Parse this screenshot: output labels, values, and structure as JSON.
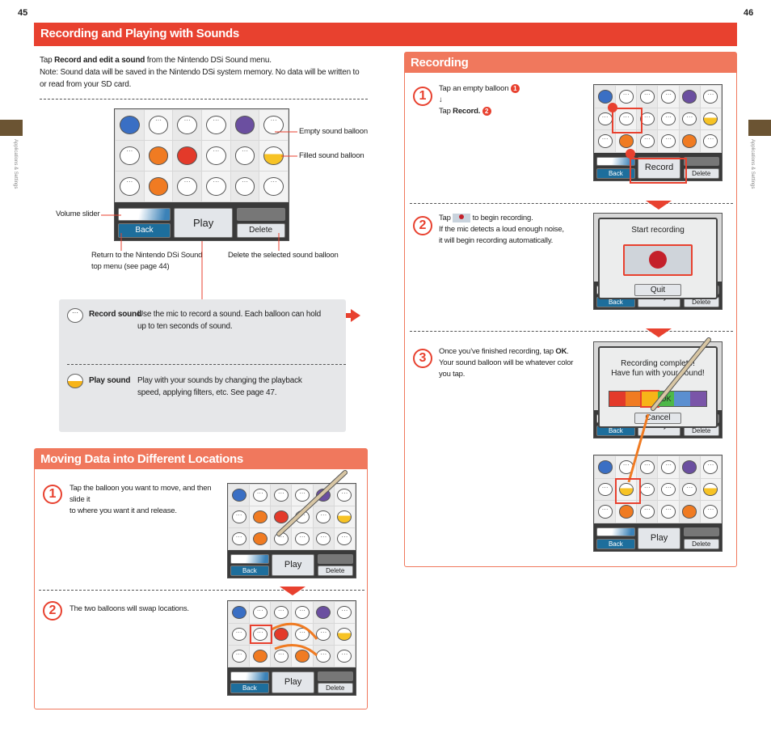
{
  "page_numbers": {
    "left": "45",
    "right": "46"
  },
  "side_tab": "Applications & Settings",
  "main_header": "Recording and Playing with Sounds",
  "intro": {
    "l1_pre": "Tap ",
    "l1_bold": "Record and edit a sound",
    "l1_post": " from the Nintendo DSi Sound menu.",
    "l2": "Note: Sound data will be saved in the Nintendo DSi system memory. No data will be written to",
    "l3": "or read from your SD card."
  },
  "callouts": {
    "empty": "Empty sound balloon",
    "filled": "Filled sound balloon",
    "volume": "Volume slider",
    "return1": "Return to the Nintendo DSi Sound",
    "return2": "top menu (see page 44)",
    "delete": "Delete the selected sound balloon"
  },
  "screen_ui": {
    "back": "Back",
    "play": "Play",
    "delete": "Delete",
    "record": "Record",
    "start_recording": "Start recording",
    "quit": "Quit",
    "complete1": "Recording complete!",
    "complete2": "Have fun with your sound!",
    "ok": "OK",
    "cancel": "Cancel"
  },
  "colors": {
    "accent": "#e8412f",
    "panel": "#f0785d",
    "blue": "#3a6fc4",
    "orange": "#f07b22",
    "red": "#e33a2a",
    "yellow": "#f7c325",
    "purple": "#6b4fa0"
  },
  "balloon_grids": {
    "main": [
      [
        "blue",
        "empty",
        "empty",
        "empty",
        "purple",
        "empty"
      ],
      [
        "empty",
        "orange",
        "red",
        "empty",
        "empty",
        "yellow"
      ],
      [
        "empty",
        "orange",
        "empty",
        "empty",
        "empty",
        "empty"
      ]
    ],
    "move1": [
      [
        "blue",
        "empty",
        "empty",
        "empty",
        "purple",
        "empty"
      ],
      [
        "empty",
        "orange",
        "red",
        "empty",
        "empty",
        "yellow"
      ],
      [
        "empty",
        "orange",
        "empty",
        "empty",
        "empty",
        "empty"
      ]
    ],
    "move2": [
      [
        "blue",
        "empty",
        "empty",
        "empty",
        "purple",
        "empty"
      ],
      [
        "empty",
        "empty",
        "red",
        "empty",
        "empty",
        "yellow"
      ],
      [
        "empty",
        "orange",
        "empty",
        "orange",
        "empty",
        "empty"
      ]
    ],
    "rec1": [
      [
        "blue",
        "empty",
        "empty",
        "empty",
        "purple",
        "empty"
      ],
      [
        "empty",
        "empty",
        "empty",
        "empty",
        "empty",
        "yellow"
      ],
      [
        "empty",
        "orange",
        "empty",
        "empty",
        "orange",
        "empty"
      ]
    ],
    "rec4": [
      [
        "blue",
        "empty",
        "empty",
        "empty",
        "purple",
        "empty"
      ],
      [
        "empty",
        "yellow",
        "empty",
        "empty",
        "empty",
        "yellow"
      ],
      [
        "empty",
        "orange",
        "empty",
        "empty",
        "orange",
        "empty"
      ]
    ]
  },
  "palette": [
    "#e33a2a",
    "#f07b22",
    "#f7b418",
    "#4db848",
    "#5b8fd0",
    "#7a55a8"
  ],
  "info": {
    "record_title": "Record sound",
    "record_desc1": "Use the mic to record a sound. Each balloon can hold",
    "record_desc2": "up to ten seconds of sound.",
    "play_title": "Play sound",
    "play_desc1": "Play with your sounds by changing the playback",
    "play_desc2": "speed,  applying filters, etc. See page 47."
  },
  "moving": {
    "title": "Moving Data into Different Locations",
    "step1_num": "1",
    "step1_a": "Tap the balloon you want to move, and then slide it",
    "step1_b": "to where you want it and release.",
    "step2_num": "2",
    "step2": "The two balloons will swap locations."
  },
  "recording": {
    "title": "Recording",
    "step1_num": "1",
    "s1_a": "Tap an empty balloon",
    "badge1": "1",
    "arrow": "↓",
    "s1_tap": "Tap ",
    "s1_bold": "Record.",
    "badge2": "2",
    "step2_num": "2",
    "s2_tap": "Tap ",
    "s2_b": "to begin recording.",
    "s2_c": "If the mic detects a loud enough noise,",
    "s2_d": "it will begin recording automatically.",
    "step3_num": "3",
    "s3_a": "Once you’ve finished recording, tap ",
    "s3_ok": "OK",
    "s3_b": "Your sound balloon will be whatever color",
    "s3_c": "you tap."
  }
}
